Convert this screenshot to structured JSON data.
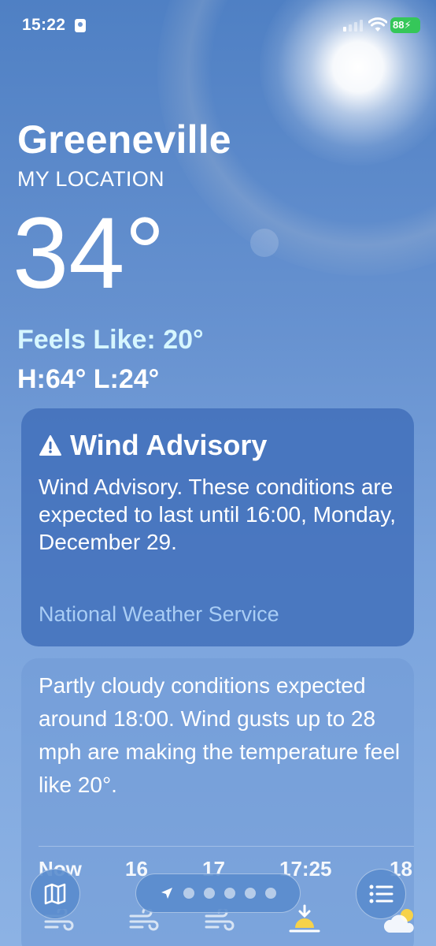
{
  "status_bar": {
    "time": "15:22",
    "battery": "88"
  },
  "weather": {
    "location": "Greeneville",
    "subtitle": "MY LOCATION",
    "temperature": "34°",
    "feels_like": "Feels Like: 20°",
    "high_low": "H:64°  L:24°"
  },
  "advisory": {
    "title": "Wind Advisory",
    "body": "Wind Advisory. These conditions are expected to last until 16:00, Monday, December 29.",
    "source": "National Weather Service"
  },
  "forecast": {
    "summary": "Partly cloudy conditions expected around 18:00. Wind gusts up to 28 mph are making the temperature feel like 20°.",
    "hours": [
      "Now",
      "16",
      "17",
      "17:25",
      "18"
    ],
    "hour_icons": [
      "wind-icon",
      "wind-icon",
      "wind-icon",
      "sunset-icon",
      "partly-cloudy-icon"
    ]
  },
  "colors": {
    "feels_like": "#d6f6ff",
    "advisory_source": "#a9cdf5",
    "battery": "#35c759"
  },
  "page_indicator": {
    "pages": 5,
    "current_icon": "location-arrow-icon"
  }
}
